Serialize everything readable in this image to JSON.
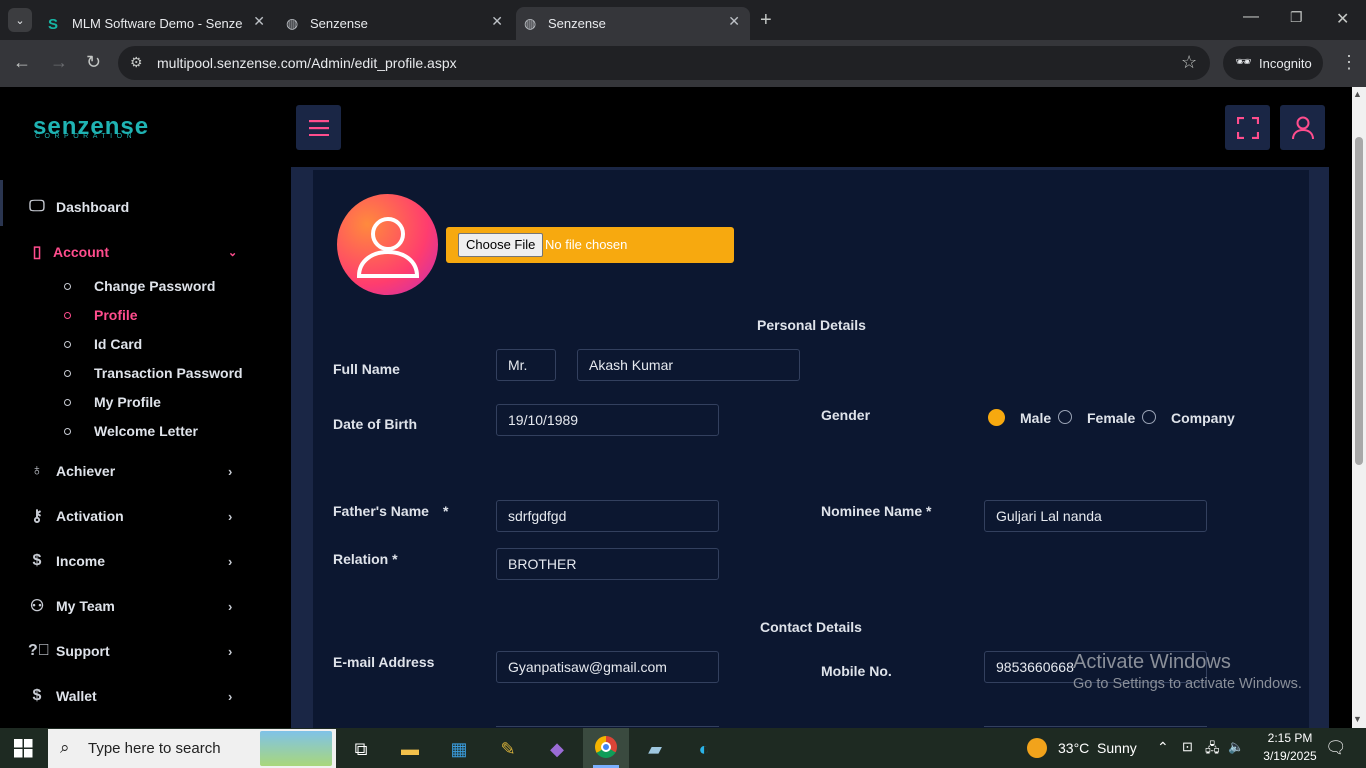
{
  "browser": {
    "tabs": [
      {
        "title": "MLM Software Demo - Senzense",
        "favicon": "s-logo-icon"
      },
      {
        "title": "Senzense",
        "favicon": "globe-icon"
      },
      {
        "title": "Senzense",
        "favicon": "globe-icon",
        "active": true
      }
    ],
    "url": "multipool.senzense.com/Admin/edit_profile.aspx",
    "incognito_label": "Incognito"
  },
  "brand": {
    "name": "senzense",
    "tagline": "CORPORATION"
  },
  "sidebar": {
    "items": [
      {
        "label": "Dashboard",
        "icon": "monitor-icon"
      },
      {
        "label": "Account",
        "icon": "book-icon",
        "expanded": true
      },
      {
        "label": "Achiever",
        "icon": "award-icon"
      },
      {
        "label": "Activation",
        "icon": "key-icon"
      },
      {
        "label": "Income",
        "icon": "dollar-icon"
      },
      {
        "label": "My Team",
        "icon": "users-icon"
      },
      {
        "label": "Support",
        "icon": "help-icon"
      },
      {
        "label": "Wallet",
        "icon": "dollar-icon"
      }
    ],
    "account_sub": [
      "Change Password",
      "Profile",
      "Id Card",
      "Transaction Password",
      "My Profile",
      "Welcome Letter"
    ]
  },
  "form": {
    "file_button": "Choose File",
    "file_status": "No file chosen",
    "personal_title": "Personal Details",
    "full_name_label": "Full Name",
    "title_value": "Mr.",
    "full_name_value": "Akash Kumar",
    "dob_label": "Date of Birth",
    "dob_value": "19/10/1989",
    "gender_label": "Gender",
    "gender_options": [
      "Male",
      "Female",
      "Company"
    ],
    "gender_selected": "Male",
    "father_label": "Father's Name",
    "father_required": "*",
    "father_value": "sdrfgdfgd",
    "nominee_label": "Nominee Name *",
    "nominee_value": "Guljari Lal nanda",
    "relation_label": "Relation *",
    "relation_value": "BROTHER",
    "contact_title": "Contact Details",
    "email_label": "E-mail Address",
    "email_value": "Gyanpatisaw@gmail.com",
    "mobile_label": "Mobile No.",
    "mobile_value": "9853660668"
  },
  "watermark": {
    "line1": "Activate Windows",
    "line2": "Go to Settings to activate Windows."
  },
  "taskbar": {
    "search_placeholder": "Type here to search",
    "weather": "33°C  Sunny",
    "time": "2:15 PM",
    "date": "3/19/2025"
  },
  "colors": {
    "accent_pink": "#ff4d8d",
    "accent_orange": "#f7a90f",
    "brand_teal": "#1fb3b3",
    "panel": "#0c1730"
  }
}
